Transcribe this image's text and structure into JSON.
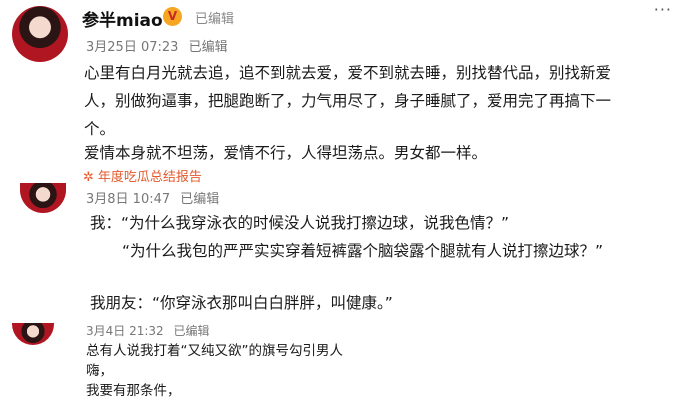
{
  "post1": {
    "username": "参半miao",
    "vip_badge": "V",
    "follow_status": "已编辑",
    "more": "···",
    "date": "3月25日 07:23",
    "edited": "已编辑",
    "lines": [
      "心里有白月光就去追，追不到就去爱，爱不到就去睡，别找替代品，别找新爱",
      "人，别做狗逼事，把腿跑断了，力气用尽了，身子睡腻了，爱用完了再搞下一",
      "个。",
      "   爱情本身就不坦荡，爱情不行，人得坦荡点。男女都一样。"
    ],
    "tag": "年度吃瓜总结报告"
  },
  "post2": {
    "date": "3月8日 10:47",
    "edited": "已编辑",
    "lines": [
      "我：“为什么我穿泳衣的时候没人说我打擦边球，说我色情？”",
      "“为什么我包的严严实实穿着短裤露个脑袋露个腿就有人说打擦边球？”",
      "我朋友：“你穿泳衣那叫白白胖胖，叫健康。”"
    ]
  },
  "post3": {
    "date": "3月4日 21:32",
    "edited": "已编辑",
    "lines": [
      "总有人说我打着“又纯又欲”的旗号勾引男人",
      "嗨，",
      "我要有那条件，"
    ]
  },
  "colors": {
    "accent": "#e25a2e",
    "meta": "#777777"
  },
  "icons": {
    "tag": "firework-icon",
    "vip": "vip-badge-icon"
  }
}
